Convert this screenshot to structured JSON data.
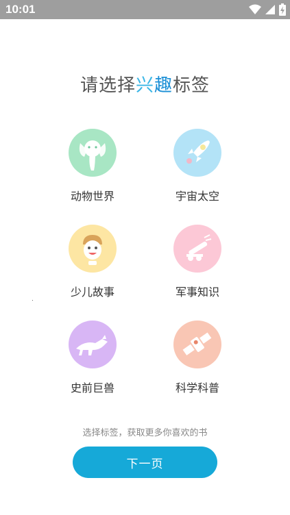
{
  "status_bar": {
    "time": "10:01"
  },
  "title": {
    "prefix": "请选择",
    "highlight_1": "兴",
    "highlight_2": "趣",
    "suffix": "标签"
  },
  "tags": [
    {
      "label": "动物世界",
      "icon": "elephant-icon",
      "color": "#a8e6c4"
    },
    {
      "label": "宇宙太空",
      "icon": "rocket-icon",
      "color": "#b3e3f7"
    },
    {
      "label": "少儿故事",
      "icon": "child-face-icon",
      "color": "#fde6a3"
    },
    {
      "label": "军事知识",
      "icon": "cannon-icon",
      "color": "#fcc8d6"
    },
    {
      "label": "史前巨兽",
      "icon": "dinosaur-icon",
      "color": "#d8b6f5"
    },
    {
      "label": "科学科普",
      "icon": "satellite-icon",
      "color": "#f9c6b4"
    }
  ],
  "hint": "选择标签，获取更多你喜欢的书",
  "next_button": {
    "label": "下一页",
    "color": "#16a9d8"
  }
}
